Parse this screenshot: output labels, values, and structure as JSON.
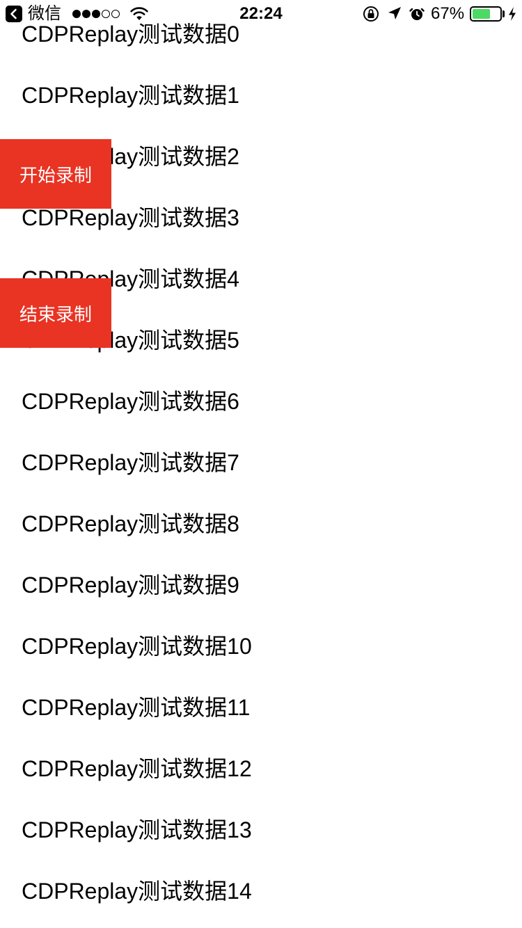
{
  "status_bar": {
    "back_app": "微信",
    "time": "22:24",
    "battery_percent": "67%",
    "battery_level": 0.67,
    "battery_color": "#4cd964",
    "signal_bars_full": 3,
    "signal_bars_total": 5,
    "icons": [
      "back-icon",
      "signal-icon",
      "wifi-icon",
      "orientation-lock-icon",
      "location-arrow-icon",
      "alarm-icon",
      "battery-icon",
      "charging-bolt-icon"
    ]
  },
  "list": {
    "items": [
      "CDPReplay测试数据0",
      "CDPReplay测试数据1",
      "CDPReplay测试数据2",
      "CDPReplay测试数据3",
      "CDPReplay测试数据4",
      "CDPReplay测试数据5",
      "CDPReplay测试数据6",
      "CDPReplay测试数据7",
      "CDPReplay测试数据8",
      "CDPReplay测试数据9",
      "CDPReplay测试数据10",
      "CDPReplay测试数据11",
      "CDPReplay测试数据12",
      "CDPReplay测试数据13",
      "CDPReplay测试数据14"
    ]
  },
  "buttons": {
    "start_label": "开始录制",
    "stop_label": "结束录制",
    "color": "#e93323"
  }
}
